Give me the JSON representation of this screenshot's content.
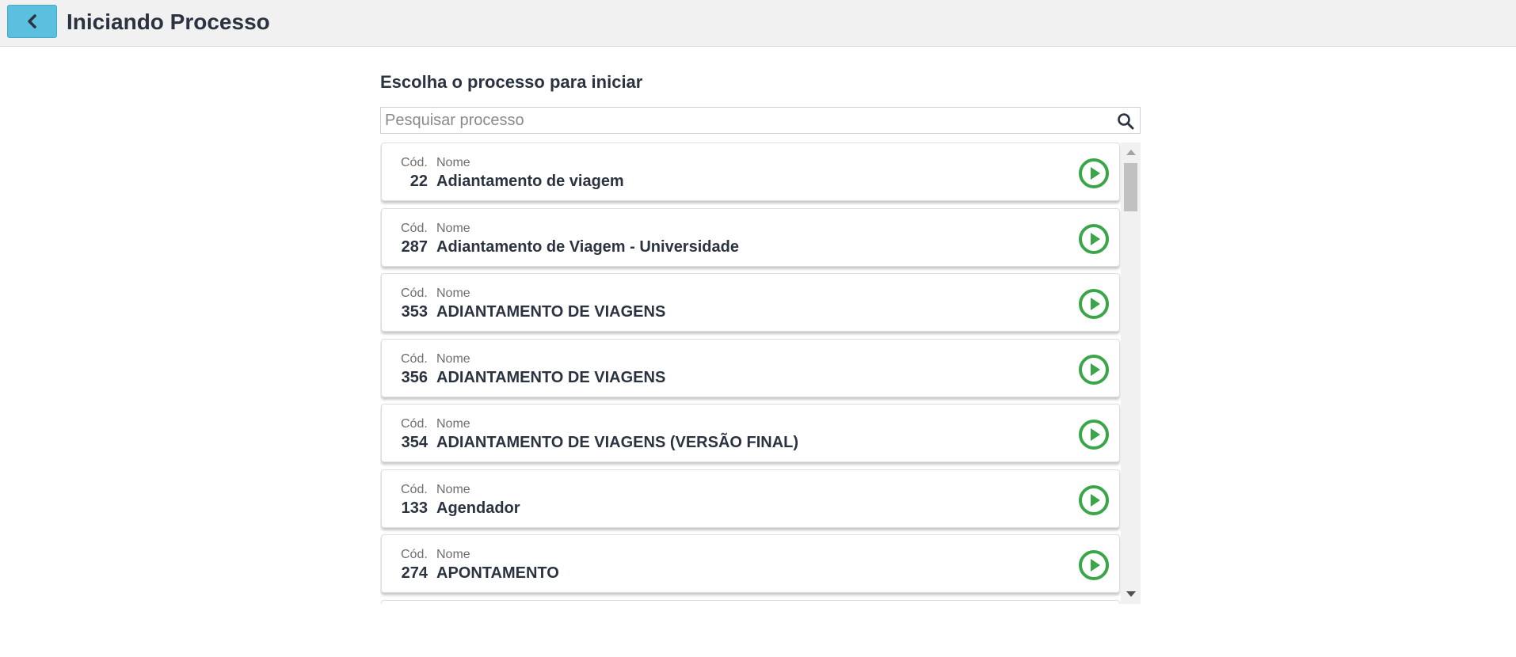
{
  "header": {
    "title": "Iniciando Processo",
    "back_icon": "chevron-left-icon"
  },
  "main": {
    "section_title": "Escolha o processo para iniciar",
    "search": {
      "placeholder": "Pesquisar processo",
      "value": "",
      "icon": "search-icon"
    },
    "list": {
      "cod_label": "Cód.",
      "nome_label": "Nome",
      "action_icon": "play-circle-icon",
      "accent_color": "#3aa649",
      "items": [
        {
          "cod": "22",
          "nome": "Adiantamento de viagem"
        },
        {
          "cod": "287",
          "nome": "Adiantamento de Viagem - Universidade"
        },
        {
          "cod": "353",
          "nome": "ADIANTAMENTO DE VIAGENS"
        },
        {
          "cod": "356",
          "nome": "ADIANTAMENTO DE VIAGENS"
        },
        {
          "cod": "354",
          "nome": "ADIANTAMENTO DE VIAGENS (VERSÃO FINAL)"
        },
        {
          "cod": "133",
          "nome": "Agendador"
        },
        {
          "cod": "274",
          "nome": "APONTAMENTO"
        }
      ]
    }
  },
  "colors": {
    "back_button": "#5bc0de",
    "header_bg": "#f1f1f1",
    "text": "#2b3340"
  }
}
